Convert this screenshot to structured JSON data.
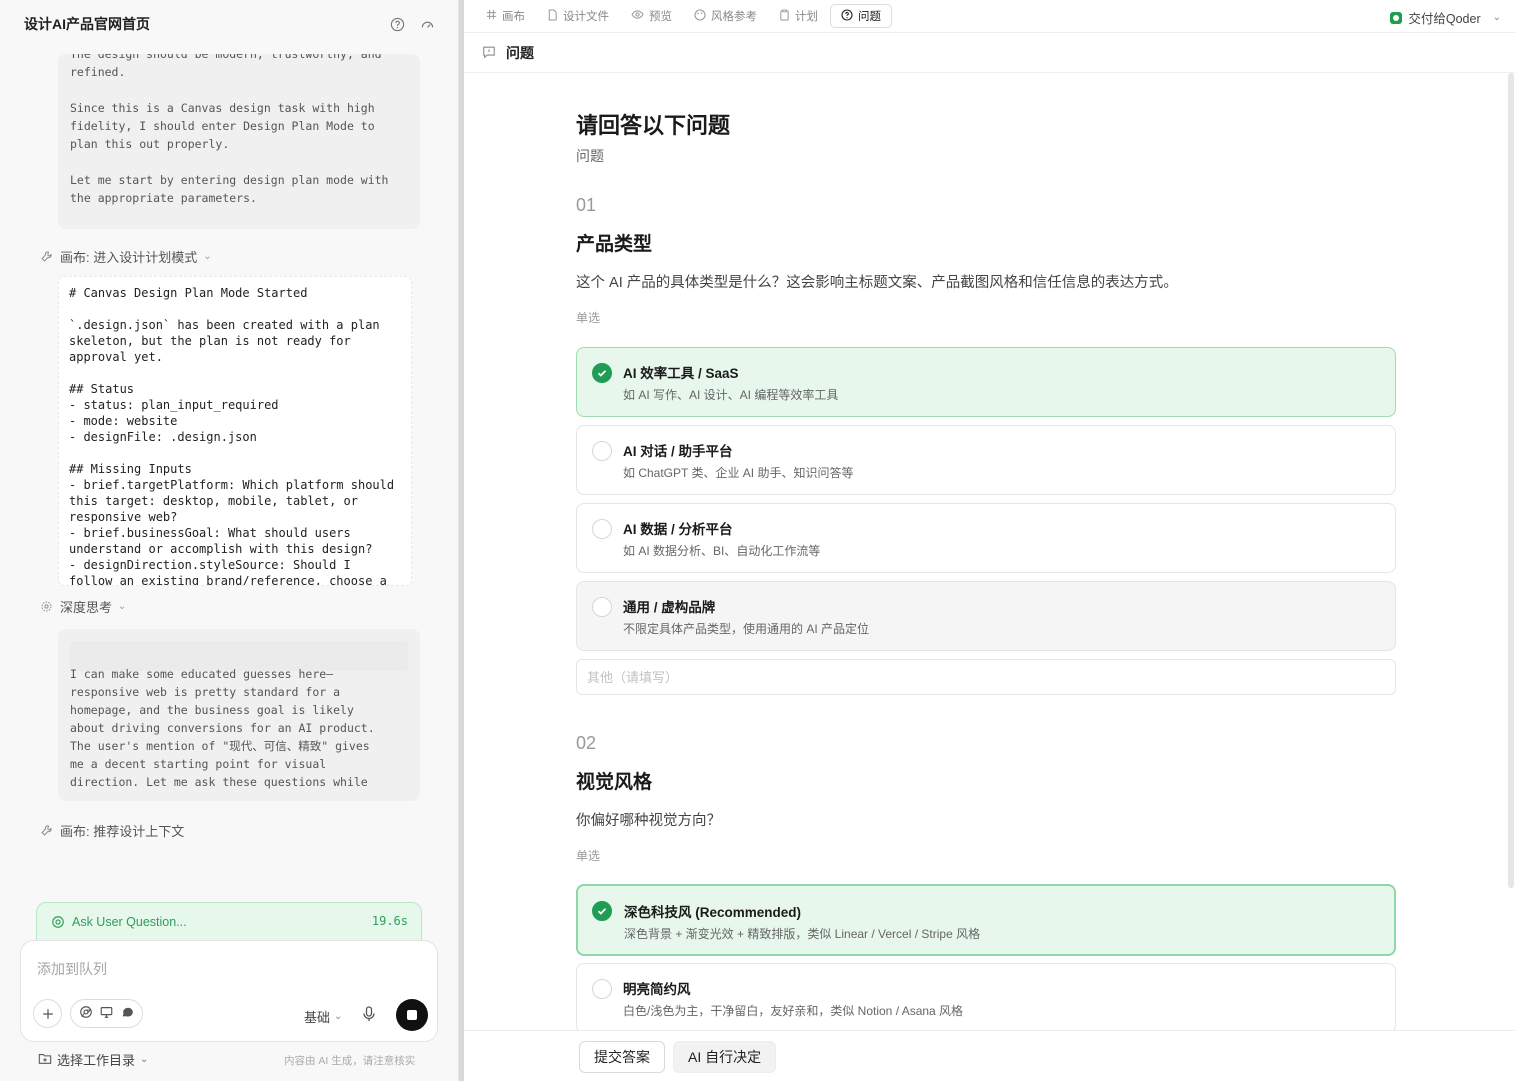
{
  "left_panel": {
    "title": "设计AI产品官网首页",
    "thinking_block_1": "The design should be modern, trustworthy, and\nrefined.\n\nSince this is a Canvas design task with high\nfidelity, I should enter Design Plan Mode to\nplan this out properly.\n\nLet me start by entering design plan mode with\nthe appropriate parameters.",
    "tool_call_1": "画布: 进入设计计划模式",
    "tool_output_1": "# Canvas Design Plan Mode Started\n\n`.design.json` has been created with a plan\nskeleton, but the plan is not ready for\napproval yet.\n\n## Status\n- status: plan_input_required\n- mode: website\n- designFile: .design.json\n\n## Missing Inputs\n- brief.targetPlatform: Which platform should\nthis target: desktop, mobile, tablet, or\nresponsive web?\n- brief.businessGoal: What should users\nunderstand or accomplish with this design?\n- designDirection.styleSource: Should I\nfollow an existing brand/reference, choose a",
    "deep_thinking_label": "深度思考",
    "thinking_block_2": "I can make some educated guesses here—\nresponsive web is pretty standard for a\nhomepage, and the business goal is likely\nabout driving conversions for an AI product.\nThe user's mention of \"现代、可信、精致\" gives\nme a decent starting point for visual\ndirection. Let me ask these questions while",
    "tool_call_2": "画布: 推荐设计上下文",
    "status": {
      "label": "Ask User Question...",
      "time": "19.6s"
    },
    "input_placeholder": "添加到队列",
    "mode_select": "基础",
    "workdir_label": "选择工作目录",
    "footer_note": "内容由 AI 生成，请注意核实"
  },
  "tabs": [
    {
      "label": "画布",
      "icon": "hash-icon",
      "active": false
    },
    {
      "label": "设计文件",
      "icon": "file-icon",
      "active": false
    },
    {
      "label": "预览",
      "icon": "eye-icon",
      "active": false
    },
    {
      "label": "风格参考",
      "icon": "palette-icon",
      "active": false
    },
    {
      "label": "计划",
      "icon": "clipboard-icon",
      "active": false
    },
    {
      "label": "问题",
      "icon": "question-icon",
      "active": true
    }
  ],
  "deliver_label": "交付给Qoder",
  "panel_heading": "问题",
  "main": {
    "title": "请回答以下问题",
    "subtitle": "问题",
    "questions": [
      {
        "number": "01",
        "title": "产品类型",
        "description": "这个 AI 产品的具体类型是什么？这会影响主标题文案、产品截图风格和信任信息的表达方式。",
        "type": "单选",
        "options": [
          {
            "label": "AI 效率工具 / SaaS",
            "desc": "如 AI 写作、AI 设计、AI 编程等效率工具",
            "selected": true
          },
          {
            "label": "AI 对话 / 助手平台",
            "desc": "如 ChatGPT 类、企业 AI 助手、知识问答等",
            "selected": false
          },
          {
            "label": "AI 数据 / 分析平台",
            "desc": "如 AI 数据分析、BI、自动化工作流等",
            "selected": false
          },
          {
            "label": "通用 / 虚构品牌",
            "desc": "不限定具体产品类型，使用通用的 AI 产品定位",
            "selected": false
          }
        ],
        "other_placeholder": "其他（请填写）"
      },
      {
        "number": "02",
        "title": "视觉风格",
        "description": "你偏好哪种视觉方向？",
        "type": "单选",
        "options": [
          {
            "label": "深色科技风 (Recommended)",
            "desc": "深色背景 + 渐变光效 + 精致排版，类似 Linear / Vercel / Stripe 风格",
            "selected": true
          },
          {
            "label": "明亮简约风",
            "desc": "白色/浅色为主，干净留白，友好亲和，类似 Notion / Asana 风格",
            "selected": false
          }
        ]
      }
    ]
  },
  "actions": {
    "submit": "提交答案",
    "ai_decide": "AI 自行决定"
  },
  "colors": {
    "accent_green": "#1f9d55",
    "selected_bg": "#e7f7ec",
    "selected_border": "#9edcb3"
  }
}
